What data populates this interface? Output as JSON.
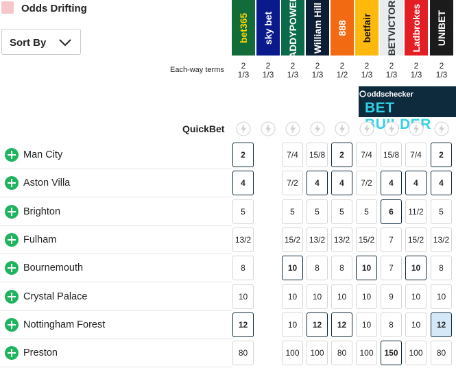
{
  "legend": {
    "label": "Odds Drifting",
    "color": "#f7c6cb"
  },
  "sort": {
    "label": "Sort By",
    "icon": "chevron-down-icon"
  },
  "bookmakers": [
    {
      "name": "bet365",
      "bg": "#116c3a",
      "fg": "#ffd500"
    },
    {
      "name": "sky bet",
      "bg": "#0a1a8c",
      "fg": "#ffffff"
    },
    {
      "name": "PADDYPOWER.",
      "bg": "#0a6b4b",
      "fg": "#ffffff"
    },
    {
      "name": "William Hill",
      "bg": "#0c1e36",
      "fg": "#ffffff"
    },
    {
      "name": "888",
      "bg": "#f26a12",
      "fg": "#ffffff"
    },
    {
      "name": "betfair",
      "bg": "#ffb80c",
      "fg": "#111111"
    },
    {
      "name": "BETVICTOR",
      "bg": "#e9edf0",
      "fg": "#333333"
    },
    {
      "name": "Ladbrokes",
      "bg": "#e31e24",
      "fg": "#ffffff"
    },
    {
      "name": "UNIBET",
      "bg": "#1b1b1b",
      "fg": "#ffffff"
    }
  ],
  "each_way": {
    "label": "Each-way terms",
    "terms": [
      [
        "2",
        "1/3"
      ],
      [
        "2",
        "1/3"
      ],
      [
        "2",
        "1/3"
      ],
      [
        "2",
        "1/3"
      ],
      [
        "2",
        "1/2"
      ],
      [
        "2",
        "1/3"
      ],
      [
        "2",
        "1/3"
      ],
      [
        "2",
        "1/3"
      ],
      [
        "2",
        "1/3"
      ]
    ]
  },
  "bet_builder": {
    "top": "oddschecker",
    "main": "BET BUILDER"
  },
  "quickbet": {
    "label": "QuickBet"
  },
  "rows": [
    {
      "team": "Man City",
      "odds": [
        "2",
        "7/4",
        "15/8",
        "2",
        "7/4",
        "15/8",
        "7/4",
        "2"
      ],
      "best": [
        0,
        3,
        7
      ]
    },
    {
      "team": "Aston Villa",
      "odds": [
        "4",
        "7/2",
        "4",
        "4",
        "7/2",
        "4",
        "4",
        "4"
      ],
      "best": [
        0,
        2,
        3,
        5,
        6,
        7
      ]
    },
    {
      "team": "Brighton",
      "odds": [
        "5",
        "5",
        "5",
        "5",
        "5",
        "6",
        "11/2",
        "5"
      ],
      "best": [
        5
      ]
    },
    {
      "team": "Fulham",
      "odds": [
        "13/2",
        "15/2",
        "13/2",
        "13/2",
        "15/2",
        "7",
        "15/2",
        "13/2"
      ],
      "best": []
    },
    {
      "team": "Bournemouth",
      "odds": [
        "8",
        "10",
        "8",
        "8",
        "10",
        "7",
        "10",
        "8"
      ],
      "best": [
        1,
        4,
        6
      ]
    },
    {
      "team": "Crystal Palace",
      "odds": [
        "10",
        "10",
        "10",
        "10",
        "10",
        "9",
        "10",
        "10"
      ],
      "best": []
    },
    {
      "team": "Nottingham Forest",
      "odds": [
        "12",
        "10",
        "12",
        "12",
        "10",
        "8",
        "10",
        "12"
      ],
      "best": [
        0,
        2,
        3
      ],
      "highlight": [
        7
      ]
    },
    {
      "team": "Preston",
      "odds": [
        "80",
        "100",
        "100",
        "80",
        "100",
        "150",
        "100",
        "80"
      ],
      "best": [
        5
      ]
    }
  ]
}
